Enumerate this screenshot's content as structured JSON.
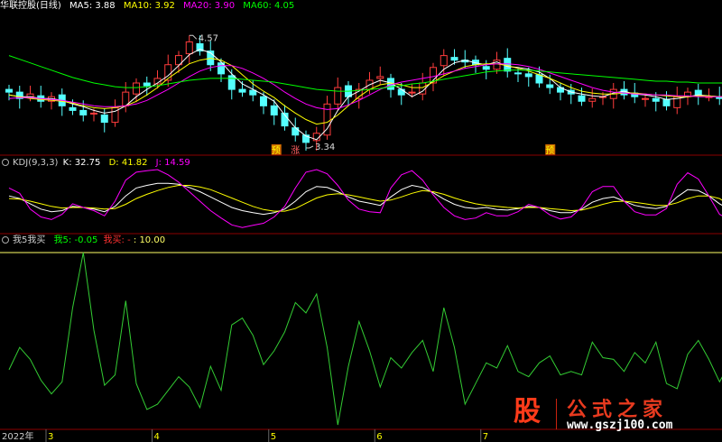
{
  "colors": {
    "up": "#ff3c3c",
    "down": "#54ffff",
    "ma5": "#ffffff",
    "ma10": "#ffff00",
    "ma20": "#ff00ff",
    "ma60": "#00ff00",
    "k": "#ffffff",
    "d": "#ffff00",
    "j": "#ff00ff",
    "buy": "#ff3030",
    "ref": "#ffff66",
    "sep": "#8b0000"
  },
  "price_header": {
    "title": "华联控股(日线)",
    "ma5": "MA5: 3.88",
    "ma10": "MA10: 3.92",
    "ma20": "MA20: 3.90",
    "ma60": "MA60: 4.05"
  },
  "kdj_header": {
    "title": "KDJ(9,3,3)",
    "k": "K: 32.75",
    "d": "D: 41.82",
    "j": "J: 14.59"
  },
  "ind_header": {
    "title": "我5我买",
    "w5": "我5: -0.05",
    "buy": "我买: -",
    "ref": ": 10.00"
  },
  "price_labels": {
    "high": "4.57",
    "low": "3.34"
  },
  "markers": [
    {
      "text": "预",
      "bg": "#cc6600",
      "color": "#ffff00"
    },
    {
      "text": "涨",
      "bg": "#000000",
      "color": "#ff6060"
    },
    {
      "text": "预",
      "bg": "#cc6600",
      "color": "#ffff00"
    }
  ],
  "x_labels": [
    {
      "text": "2022年",
      "color": "#cccccc"
    },
    {
      "text": "3",
      "color": "#ffff00"
    },
    {
      "text": "4",
      "color": "#ffff00"
    },
    {
      "text": "5",
      "color": "#ffff00"
    },
    {
      "text": "6",
      "color": "#ffff00"
    },
    {
      "text": "7",
      "color": "#ffff00"
    }
  ],
  "watermark": {
    "logo": "股",
    "name": "公式之家",
    "url": "www.gszj100.com"
  },
  "chart_data": [
    {
      "type": "candlestick",
      "ylim": [
        3.3,
        4.8
      ],
      "annotations": [
        "4.57",
        "3.34"
      ],
      "series": [
        {
          "name": "MA5",
          "values": [
            3.92,
            3.9,
            3.9,
            3.88,
            3.88,
            3.86,
            3.82,
            3.79,
            3.75,
            3.72,
            3.74,
            3.8,
            3.9,
            3.98,
            4.05,
            4.13,
            4.24,
            4.36,
            4.42,
            4.38,
            4.28,
            4.15,
            4.04,
            3.98,
            3.92,
            3.85,
            3.7,
            3.56,
            3.47,
            3.43,
            3.55,
            3.75,
            3.9,
            3.96,
            4.03,
            4.08,
            4.05,
            3.98,
            3.9,
            3.96,
            4.08,
            4.2,
            4.27,
            4.3,
            4.27,
            4.25,
            4.28,
            4.23,
            4.22,
            4.2,
            4.17,
            4.1,
            4.0,
            3.95,
            3.93,
            3.91,
            3.9,
            3.94,
            3.96,
            3.93,
            3.92,
            3.9,
            3.87,
            3.88,
            3.9,
            3.92,
            3.91,
            3.9,
            3.88
          ]
        },
        {
          "name": "MA10",
          "values": [
            3.92,
            3.9,
            3.88,
            3.87,
            3.86,
            3.85,
            3.83,
            3.8,
            3.78,
            3.77,
            3.78,
            3.8,
            3.85,
            3.92,
            4.0,
            4.1,
            4.18,
            4.26,
            4.3,
            4.32,
            4.3,
            4.24,
            4.14,
            4.04,
            3.96,
            3.89,
            3.8,
            3.72,
            3.65,
            3.6,
            3.62,
            3.7,
            3.8,
            3.9,
            3.98,
            4.03,
            4.05,
            4.03,
            4.0,
            4.0,
            4.06,
            4.13,
            4.18,
            4.23,
            4.25,
            4.26,
            4.26,
            4.24,
            4.21,
            4.18,
            4.14,
            4.1,
            4.05,
            4.0,
            3.96,
            3.94,
            3.93,
            3.93,
            3.94,
            3.94,
            3.93,
            3.92,
            3.91,
            3.9,
            3.9,
            3.91,
            3.91,
            3.9,
            3.9
          ]
        },
        {
          "name": "MA20",
          "values": [
            3.88,
            3.89,
            3.89,
            3.88,
            3.87,
            3.86,
            3.84,
            3.82,
            3.8,
            3.79,
            3.79,
            3.8,
            3.82,
            3.86,
            3.92,
            3.98,
            4.05,
            4.12,
            4.18,
            4.22,
            4.24,
            4.24,
            4.21,
            4.16,
            4.1,
            4.03,
            3.95,
            3.88,
            3.82,
            3.78,
            3.76,
            3.77,
            3.81,
            3.86,
            3.92,
            3.98,
            4.03,
            4.06,
            4.08,
            4.1,
            4.12,
            4.15,
            4.18,
            4.21,
            4.23,
            4.25,
            4.26,
            4.26,
            4.25,
            4.23,
            4.2,
            4.16,
            4.12,
            4.08,
            4.04,
            4.0,
            3.97,
            3.95,
            3.94,
            3.93,
            3.93,
            3.92,
            3.92,
            3.91,
            3.91,
            3.9,
            3.9,
            3.9,
            3.9
          ]
        },
        {
          "name": "MA60",
          "values": [
            4.35,
            4.31,
            4.27,
            4.23,
            4.19,
            4.15,
            4.11,
            4.08,
            4.05,
            4.03,
            4.01,
            4.0,
            4.0,
            4.01,
            4.02,
            4.04,
            4.06,
            4.08,
            4.09,
            4.1,
            4.1,
            4.1,
            4.09,
            4.08,
            4.07,
            4.06,
            4.04,
            4.02,
            4.0,
            3.98,
            3.97,
            3.96,
            3.96,
            3.97,
            3.98,
            3.99,
            4.01,
            4.02,
            4.04,
            4.05,
            4.07,
            4.09,
            4.11,
            4.13,
            4.15,
            4.17,
            4.18,
            4.19,
            4.19,
            4.19,
            4.18,
            4.17,
            4.16,
            4.15,
            4.14,
            4.13,
            4.12,
            4.11,
            4.1,
            4.09,
            4.08,
            4.07,
            4.07,
            4.06,
            4.06,
            4.05,
            4.05,
            4.05,
            4.05
          ]
        },
        {
          "name": "Close",
          "values": [
            3.95,
            3.88,
            3.93,
            3.85,
            3.9,
            3.8,
            3.75,
            3.7,
            3.72,
            3.62,
            3.78,
            3.95,
            4.05,
            4.02,
            4.1,
            4.25,
            4.35,
            4.5,
            4.4,
            4.25,
            4.15,
            3.98,
            3.95,
            3.92,
            3.8,
            3.7,
            3.58,
            3.48,
            3.4,
            3.5,
            3.82,
            4.0,
            3.9,
            3.98,
            4.08,
            4.12,
            3.98,
            3.92,
            3.95,
            4.05,
            4.22,
            4.35,
            4.3,
            4.28,
            4.25,
            4.2,
            4.3,
            4.18,
            4.15,
            4.12,
            4.05,
            4.0,
            3.95,
            3.93,
            3.85,
            3.88,
            3.9,
            3.98,
            3.92,
            3.9,
            3.88,
            3.85,
            3.8,
            3.9,
            3.95,
            3.92,
            3.9,
            3.88,
            3.88
          ]
        }
      ],
      "markers": [
        "预",
        "涨",
        "预"
      ]
    },
    {
      "type": "line",
      "title": "KDJ(9,3,3)",
      "ylim": [
        -10,
        110
      ],
      "series": [
        {
          "name": "K",
          "values": [
            60,
            55,
            45,
            35,
            30,
            32,
            40,
            38,
            35,
            30,
            40,
            60,
            75,
            80,
            84,
            84,
            82,
            76,
            68,
            58,
            48,
            38,
            32,
            28,
            25,
            28,
            35,
            50,
            68,
            78,
            76,
            68,
            58,
            50,
            46,
            42,
            58,
            72,
            80,
            76,
            66,
            54,
            44,
            38,
            36,
            38,
            34,
            33,
            36,
            40,
            38,
            32,
            28,
            28,
            35,
            48,
            55,
            58,
            50,
            42,
            38,
            36,
            40,
            58,
            72,
            70,
            60,
            45,
            33
          ]
        },
        {
          "name": "D",
          "values": [
            55,
            54,
            50,
            45,
            40,
            37,
            38,
            38,
            37,
            35,
            36,
            44,
            55,
            63,
            70,
            76,
            80,
            80,
            77,
            72,
            64,
            56,
            48,
            40,
            34,
            31,
            31,
            36,
            46,
            56,
            62,
            64,
            62,
            58,
            54,
            50,
            52,
            58,
            65,
            70,
            68,
            63,
            56,
            50,
            45,
            42,
            40,
            38,
            37,
            38,
            38,
            36,
            34,
            32,
            33,
            38,
            44,
            49,
            50,
            48,
            45,
            42,
            42,
            47,
            55,
            60,
            60,
            55,
            42
          ]
        },
        {
          "name": "J",
          "values": [
            75,
            65,
            35,
            20,
            15,
            25,
            45,
            38,
            32,
            22,
            50,
            90,
            105,
            108,
            110,
            100,
            86,
            68,
            50,
            32,
            18,
            5,
            0,
            4,
            8,
            20,
            40,
            75,
            105,
            110,
            102,
            80,
            52,
            35,
            30,
            28,
            75,
            100,
            108,
            90,
            62,
            38,
            22,
            15,
            18,
            28,
            22,
            22,
            30,
            44,
            38,
            24,
            16,
            20,
            38,
            68,
            78,
            78,
            50,
            30,
            24,
            24,
            36,
            82,
            104,
            92,
            60,
            25,
            14
          ]
        }
      ]
    },
    {
      "type": "line",
      "title": "我5我买",
      "ylim": [
        -0.05,
        10.0
      ],
      "series": [
        {
          "name": "我5",
          "values": [
            3.2,
            4.5,
            3.8,
            2.6,
            1.8,
            2.5,
            6.8,
            10.0,
            5.5,
            2.3,
            2.9,
            7.2,
            2.4,
            0.9,
            1.2,
            2.0,
            2.8,
            2.2,
            1.0,
            3.4,
            2.0,
            5.8,
            6.2,
            5.2,
            3.5,
            4.3,
            5.4,
            7.1,
            6.5,
            7.6,
            4.5,
            0.0,
            3.4,
            6.0,
            4.3,
            2.2,
            3.9,
            3.3,
            4.2,
            4.9,
            3.1,
            6.8,
            4.5,
            1.2,
            2.4,
            3.6,
            3.3,
            4.6,
            3.1,
            2.8,
            3.6,
            4.0,
            2.9,
            3.1,
            2.9,
            4.8,
            3.9,
            3.8,
            3.1,
            4.2,
            3.6,
            4.8,
            2.4,
            2.1,
            4.1,
            4.9,
            3.8,
            2.5,
            3.6
          ]
        },
        {
          "name": "我买",
          "values": []
        }
      ],
      "reference_line": 10.0
    }
  ]
}
